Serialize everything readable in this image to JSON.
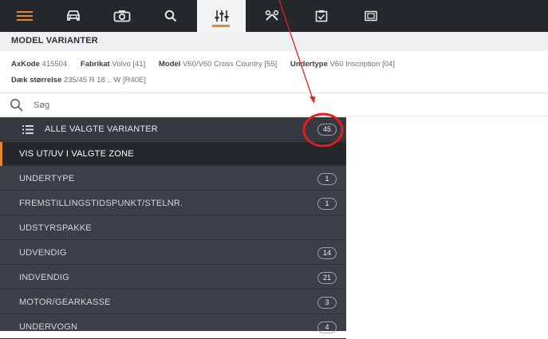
{
  "toolbar": {
    "items": [
      {
        "icon": "menu-icon"
      },
      {
        "icon": "car-icon"
      },
      {
        "icon": "camera-icon"
      },
      {
        "icon": "search-icon"
      },
      {
        "icon": "sliders-icon",
        "active": true
      },
      {
        "icon": "tools-icon"
      },
      {
        "icon": "checklist-icon"
      },
      {
        "icon": "image-icon"
      }
    ],
    "accent_color": "#e6862e",
    "background_color": "#24272b"
  },
  "header": {
    "title": "MODEL VARIANTER"
  },
  "info": {
    "axkode_label": "AxKode",
    "axkode_value": "415504",
    "fabrikat_label": "Fabrikat",
    "fabrikat_value": "Volvo [41]",
    "model_label": "Model",
    "model_value": "V60/V60 Cross Country [55]",
    "undertype_label": "Undertype",
    "undertype_value": "V60 Inscription [04]",
    "daek_label": "Dæk størrelse",
    "daek_value": "235/45 R 18 .. W [R40E]"
  },
  "search": {
    "placeholder": "Søg"
  },
  "variants": {
    "all": {
      "label": "ALLE VALGTE VARIANTER",
      "count": "45"
    },
    "zone": {
      "label": "VIS UT/UV I VALGTE ZONE"
    },
    "items": [
      {
        "label": "UNDERTYPE",
        "count": "1"
      },
      {
        "label": "FREMSTILLINGSTIDSPUNKT/STELNR.",
        "count": "1"
      },
      {
        "label": "UDSTYRSPAKKE",
        "count": ""
      },
      {
        "label": "UDVENDIG",
        "count": "14"
      },
      {
        "label": "INDVENDIG",
        "count": "21"
      },
      {
        "label": "MOTOR/GEARKASSE",
        "count": "3"
      },
      {
        "label": "UNDERVOGN",
        "count": "4"
      }
    ]
  },
  "annotation": {
    "color": "#e02020"
  }
}
